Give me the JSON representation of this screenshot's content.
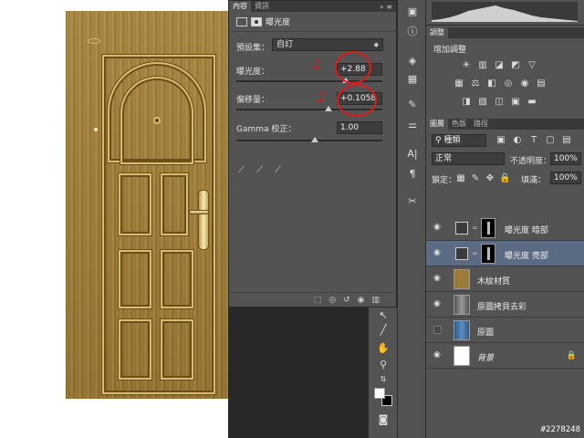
{
  "properties": {
    "tabs": [
      "內容",
      "資訊"
    ],
    "title": "曝光度",
    "preset_label": "預設集：",
    "preset_value": "自訂",
    "exposure_label": "曝光度：",
    "exposure_value": "+2.88",
    "offset_label": "偏移量：",
    "offset_value": "+0.1058",
    "gamma_label": "Gamma 校正：",
    "gamma_value": "1.00"
  },
  "annotations": [
    "1",
    "2"
  ],
  "adjustments": {
    "tab": "調整",
    "title": "增加調整"
  },
  "layers_panel": {
    "tabs": [
      "圖層",
      "色版",
      "路徑"
    ],
    "filter_value": "種類",
    "blend_mode": "正常",
    "opacity_label": "不透明度：",
    "opacity_value": "100%",
    "lock_label": "鎖定：",
    "fill_label": "填滿：",
    "fill_value": "100%",
    "layers": [
      {
        "name": "曝光度 暗部",
        "visible": true,
        "selected": false
      },
      {
        "name": "曝光度 亮部",
        "visible": true,
        "selected": true
      },
      {
        "name": "木紋材質",
        "visible": true,
        "selected": false
      },
      {
        "name": "原圖拷貝去彩",
        "visible": true,
        "selected": false
      },
      {
        "name": "原圖",
        "visible": false,
        "selected": false
      },
      {
        "name": "背景",
        "visible": true,
        "selected": false
      }
    ]
  },
  "watermark": "#2278248",
  "colors": {
    "panel_bg": "#535353",
    "workspace_bg": "#282828",
    "selected_layer": "#5c6b84",
    "annotation_red": "#e01b1b"
  }
}
